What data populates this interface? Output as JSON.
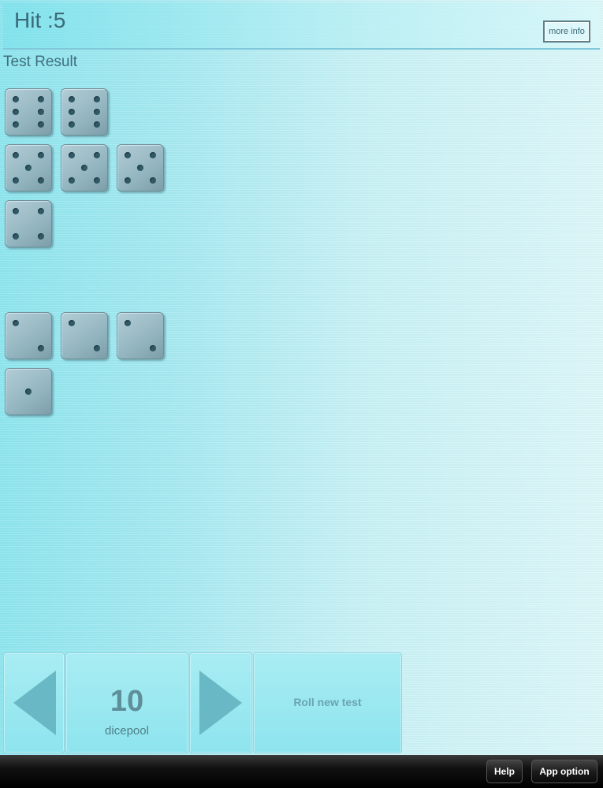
{
  "header": {
    "title": "Hit :5",
    "more_info_label": "more info"
  },
  "result": {
    "section_title": "Test Result"
  },
  "dice_rows": [
    [
      6,
      6
    ],
    [
      5,
      5,
      5
    ],
    [
      4
    ],
    [],
    [
      2,
      2,
      2
    ],
    [
      1
    ]
  ],
  "controls": {
    "decrease_icon": "triangle-left-icon",
    "increase_icon": "triangle-right-icon",
    "dicepool_value": "10",
    "dicepool_label": "dicepool",
    "roll_label": "Roll new test"
  },
  "toolbar": {
    "help_label": "Help",
    "app_option_label": "App option"
  },
  "colors": {
    "accent": "#8ee4ee",
    "die": "#93b5c0",
    "pip": "#2f5966",
    "toolbar": "#111111"
  }
}
